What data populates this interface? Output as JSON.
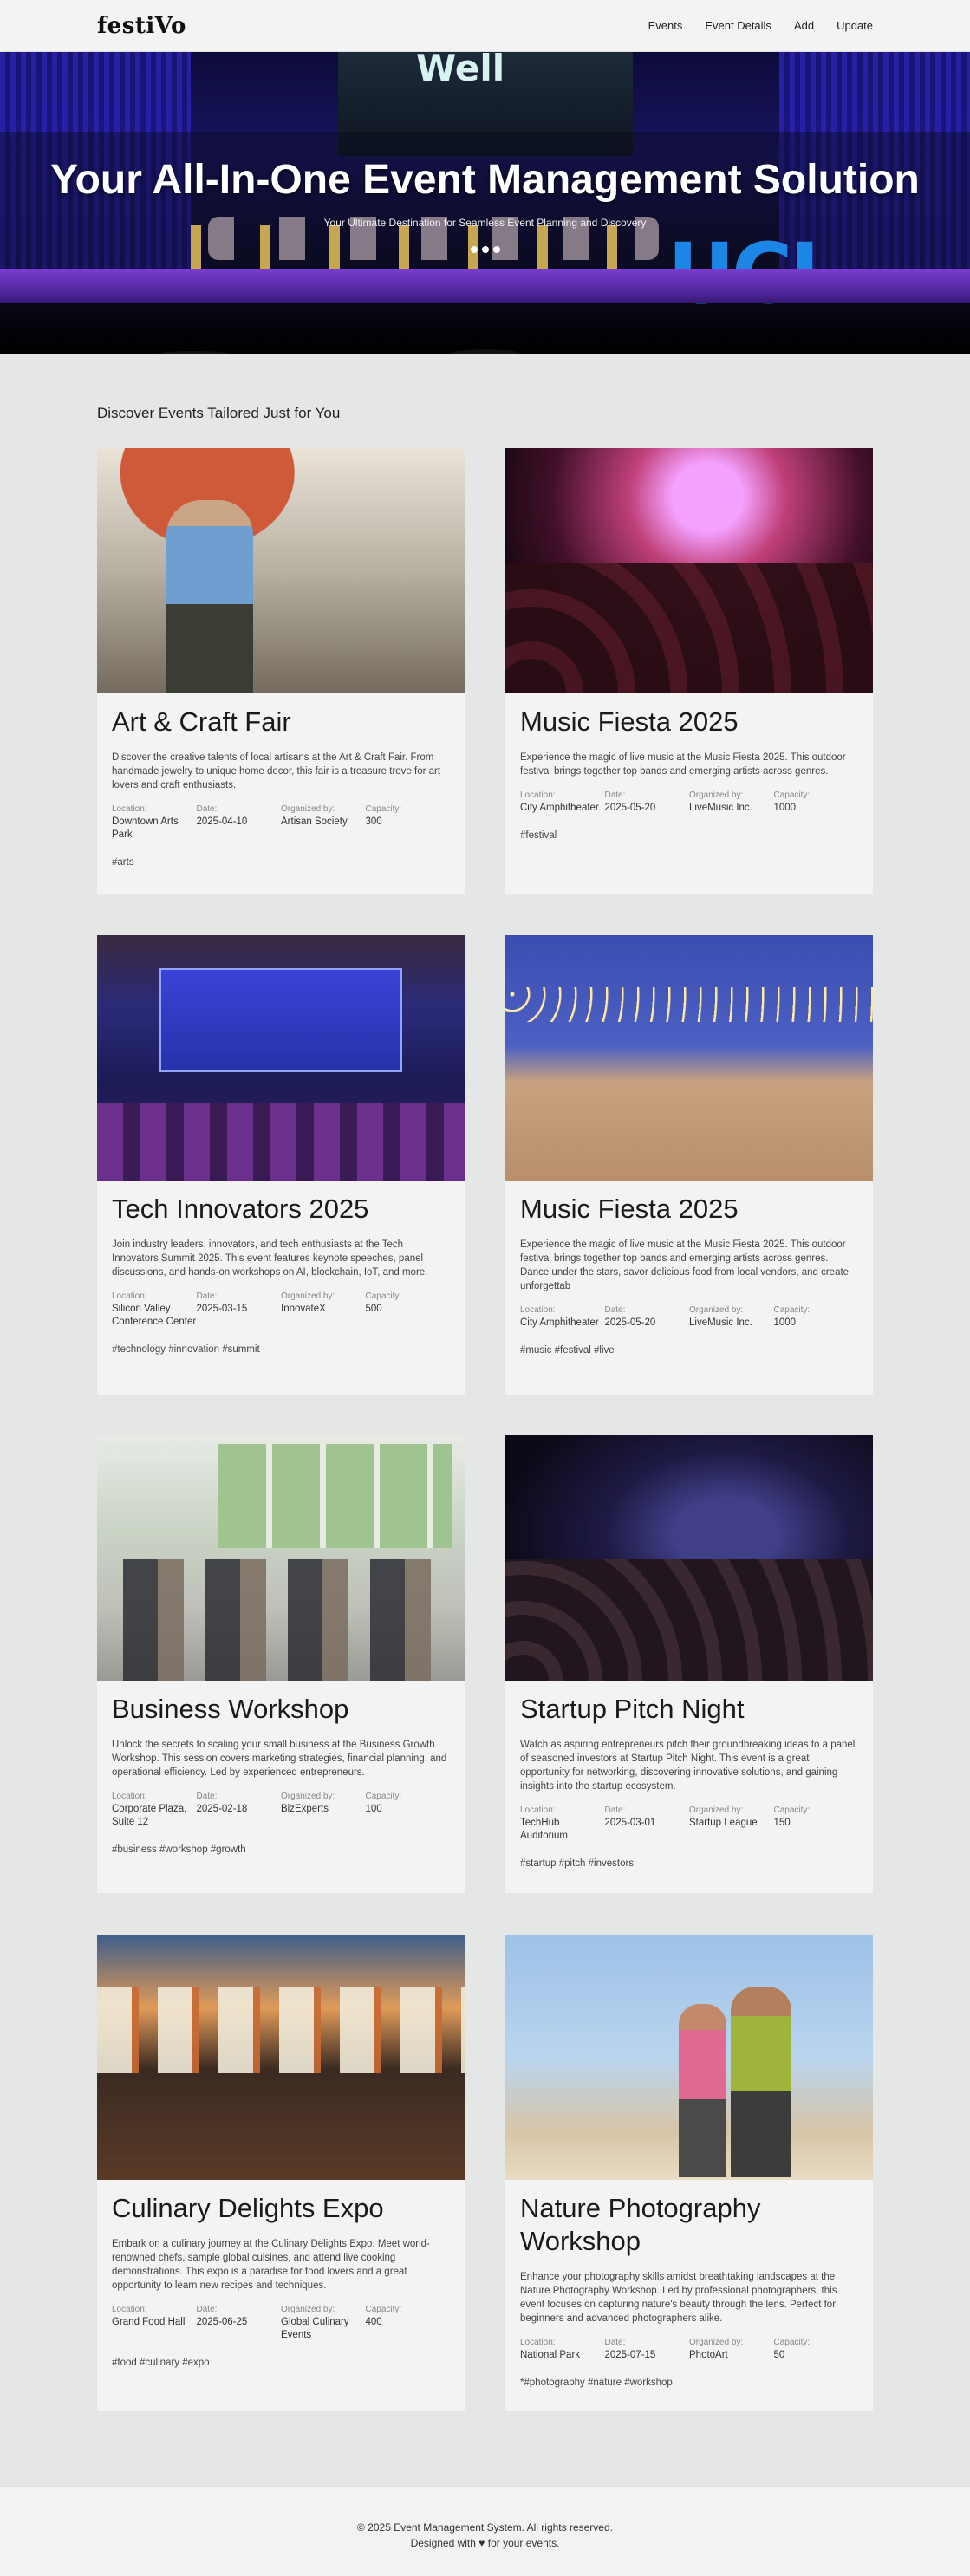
{
  "nav": {
    "brand": "festiVo",
    "links": [
      "Events",
      "Event Details",
      "Add",
      "Update"
    ]
  },
  "hero": {
    "title": "Your All-In-One Event Management Solution",
    "subtitle": "Your Ultimate Destination for Seamless Event Planning and Discovery",
    "backdrop_text_top": "Well",
    "backdrop_text_logo": "UCL"
  },
  "section": {
    "title": "Discover Events Tailored Just for You"
  },
  "meta_labels": {
    "location": "Location:",
    "date": "Date:",
    "organizer": "Organized by:",
    "capacity": "Capacity:"
  },
  "events": [
    {
      "title": "Art & Craft Fair",
      "description": "Discover the creative talents of local artisans at the Art & Craft Fair. From handmade jewelry to unique home decor, this fair is a treasure trove for art lovers and craft enthusiasts.",
      "location": "Downtown Arts Park",
      "date": "2025-04-10",
      "organizer": "Artisan Society",
      "capacity": "300",
      "tags": "#arts"
    },
    {
      "title": "Music Fiesta 2025",
      "description": "Experience the magic of live music at the Music Fiesta 2025. This outdoor festival brings together top bands and emerging artists across genres.",
      "location": "City Amphitheater",
      "date": "2025-05-20",
      "organizer": "LiveMusic Inc.",
      "capacity": "1000",
      "tags": "#festival"
    },
    {
      "title": "Tech Innovators 2025",
      "description": "Join industry leaders, innovators, and tech enthusiasts at the Tech Innovators Summit 2025. This event features keynote speeches, panel discussions, and hands-on workshops on AI, blockchain, IoT, and more.",
      "location": "Silicon Valley Conference Center",
      "date": "2025-03-15",
      "organizer": "InnovateX",
      "capacity": "500",
      "tags": "#technology #innovation #summit"
    },
    {
      "title": "Music Fiesta 2025",
      "description": "Experience the magic of live music at the Music Fiesta 2025. This outdoor festival brings together top bands and emerging artists across genres. Dance under the stars, savor delicious food from local vendors, and create unforgettab",
      "location": "City Amphitheater",
      "date": "2025-05-20",
      "organizer": "LiveMusic Inc.",
      "capacity": "1000",
      "tags": "#music #festival #live"
    },
    {
      "title": "Business Workshop",
      "description": "Unlock the secrets to scaling your small business at the Business Growth Workshop. This session covers marketing strategies, financial planning, and operational efficiency. Led by experienced entrepreneurs.",
      "location": "Corporate Plaza, Suite 12",
      "date": "2025-02-18",
      "organizer": "BizExperts",
      "capacity": "100",
      "tags": "#business #workshop #growth"
    },
    {
      "title": "Startup Pitch Night",
      "description": "Watch as aspiring entrepreneurs pitch their groundbreaking ideas to a panel of seasoned investors at Startup Pitch Night. This event is a great opportunity for networking, discovering innovative solutions, and gaining insights into the startup ecosystem.",
      "location": "TechHub Auditorium",
      "date": "2025-03-01",
      "organizer": "Startup League",
      "capacity": "150",
      "tags": "#startup #pitch #investors"
    },
    {
      "title": "Culinary Delights Expo",
      "description": "Embark on a culinary journey at the Culinary Delights Expo. Meet world-renowned chefs, sample global cuisines, and attend live cooking demonstrations. This expo is a paradise for food lovers and a great opportunity to learn new recipes and techniques.",
      "location": "Grand Food Hall",
      "date": "2025-06-25",
      "organizer": "Global Culinary Events",
      "capacity": "400",
      "tags": "#food #culinary #expo"
    },
    {
      "title": "Nature Photography Workshop",
      "description": "Enhance your photography skills amidst breathtaking landscapes at the Nature Photography Workshop. Led by professional photographers, this event focuses on capturing nature's beauty through the lens. Perfect for beginners and advanced photographers alike.",
      "location": "National Park",
      "date": "2025-07-15",
      "organizer": "PhotoArt",
      "capacity": "50",
      "tags": "*#photography #nature #workshop"
    }
  ],
  "footer": {
    "copyright": "© 2025 Event Management System. All rights reserved.",
    "credit": "Designed with ♥ for your events."
  }
}
